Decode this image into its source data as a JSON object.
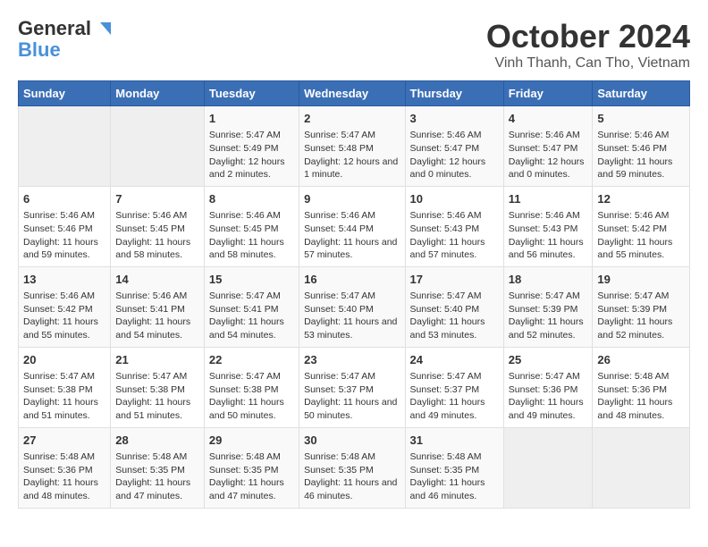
{
  "header": {
    "logo_line1": "General",
    "logo_line2": "Blue",
    "title": "October 2024",
    "subtitle": "Vinh Thanh, Can Tho, Vietnam"
  },
  "days_of_week": [
    "Sunday",
    "Monday",
    "Tuesday",
    "Wednesday",
    "Thursday",
    "Friday",
    "Saturday"
  ],
  "weeks": [
    [
      {
        "day": "",
        "content": ""
      },
      {
        "day": "",
        "content": ""
      },
      {
        "day": "1",
        "content": "Sunrise: 5:47 AM\nSunset: 5:49 PM\nDaylight: 12 hours and 2 minutes."
      },
      {
        "day": "2",
        "content": "Sunrise: 5:47 AM\nSunset: 5:48 PM\nDaylight: 12 hours and 1 minute."
      },
      {
        "day": "3",
        "content": "Sunrise: 5:46 AM\nSunset: 5:47 PM\nDaylight: 12 hours and 0 minutes."
      },
      {
        "day": "4",
        "content": "Sunrise: 5:46 AM\nSunset: 5:47 PM\nDaylight: 12 hours and 0 minutes."
      },
      {
        "day": "5",
        "content": "Sunrise: 5:46 AM\nSunset: 5:46 PM\nDaylight: 11 hours and 59 minutes."
      }
    ],
    [
      {
        "day": "6",
        "content": "Sunrise: 5:46 AM\nSunset: 5:46 PM\nDaylight: 11 hours and 59 minutes."
      },
      {
        "day": "7",
        "content": "Sunrise: 5:46 AM\nSunset: 5:45 PM\nDaylight: 11 hours and 58 minutes."
      },
      {
        "day": "8",
        "content": "Sunrise: 5:46 AM\nSunset: 5:45 PM\nDaylight: 11 hours and 58 minutes."
      },
      {
        "day": "9",
        "content": "Sunrise: 5:46 AM\nSunset: 5:44 PM\nDaylight: 11 hours and 57 minutes."
      },
      {
        "day": "10",
        "content": "Sunrise: 5:46 AM\nSunset: 5:43 PM\nDaylight: 11 hours and 57 minutes."
      },
      {
        "day": "11",
        "content": "Sunrise: 5:46 AM\nSunset: 5:43 PM\nDaylight: 11 hours and 56 minutes."
      },
      {
        "day": "12",
        "content": "Sunrise: 5:46 AM\nSunset: 5:42 PM\nDaylight: 11 hours and 55 minutes."
      }
    ],
    [
      {
        "day": "13",
        "content": "Sunrise: 5:46 AM\nSunset: 5:42 PM\nDaylight: 11 hours and 55 minutes."
      },
      {
        "day": "14",
        "content": "Sunrise: 5:46 AM\nSunset: 5:41 PM\nDaylight: 11 hours and 54 minutes."
      },
      {
        "day": "15",
        "content": "Sunrise: 5:47 AM\nSunset: 5:41 PM\nDaylight: 11 hours and 54 minutes."
      },
      {
        "day": "16",
        "content": "Sunrise: 5:47 AM\nSunset: 5:40 PM\nDaylight: 11 hours and 53 minutes."
      },
      {
        "day": "17",
        "content": "Sunrise: 5:47 AM\nSunset: 5:40 PM\nDaylight: 11 hours and 53 minutes."
      },
      {
        "day": "18",
        "content": "Sunrise: 5:47 AM\nSunset: 5:39 PM\nDaylight: 11 hours and 52 minutes."
      },
      {
        "day": "19",
        "content": "Sunrise: 5:47 AM\nSunset: 5:39 PM\nDaylight: 11 hours and 52 minutes."
      }
    ],
    [
      {
        "day": "20",
        "content": "Sunrise: 5:47 AM\nSunset: 5:38 PM\nDaylight: 11 hours and 51 minutes."
      },
      {
        "day": "21",
        "content": "Sunrise: 5:47 AM\nSunset: 5:38 PM\nDaylight: 11 hours and 51 minutes."
      },
      {
        "day": "22",
        "content": "Sunrise: 5:47 AM\nSunset: 5:38 PM\nDaylight: 11 hours and 50 minutes."
      },
      {
        "day": "23",
        "content": "Sunrise: 5:47 AM\nSunset: 5:37 PM\nDaylight: 11 hours and 50 minutes."
      },
      {
        "day": "24",
        "content": "Sunrise: 5:47 AM\nSunset: 5:37 PM\nDaylight: 11 hours and 49 minutes."
      },
      {
        "day": "25",
        "content": "Sunrise: 5:47 AM\nSunset: 5:36 PM\nDaylight: 11 hours and 49 minutes."
      },
      {
        "day": "26",
        "content": "Sunrise: 5:48 AM\nSunset: 5:36 PM\nDaylight: 11 hours and 48 minutes."
      }
    ],
    [
      {
        "day": "27",
        "content": "Sunrise: 5:48 AM\nSunset: 5:36 PM\nDaylight: 11 hours and 48 minutes."
      },
      {
        "day": "28",
        "content": "Sunrise: 5:48 AM\nSunset: 5:35 PM\nDaylight: 11 hours and 47 minutes."
      },
      {
        "day": "29",
        "content": "Sunrise: 5:48 AM\nSunset: 5:35 PM\nDaylight: 11 hours and 47 minutes."
      },
      {
        "day": "30",
        "content": "Sunrise: 5:48 AM\nSunset: 5:35 PM\nDaylight: 11 hours and 46 minutes."
      },
      {
        "day": "31",
        "content": "Sunrise: 5:48 AM\nSunset: 5:35 PM\nDaylight: 11 hours and 46 minutes."
      },
      {
        "day": "",
        "content": ""
      },
      {
        "day": "",
        "content": ""
      }
    ]
  ]
}
